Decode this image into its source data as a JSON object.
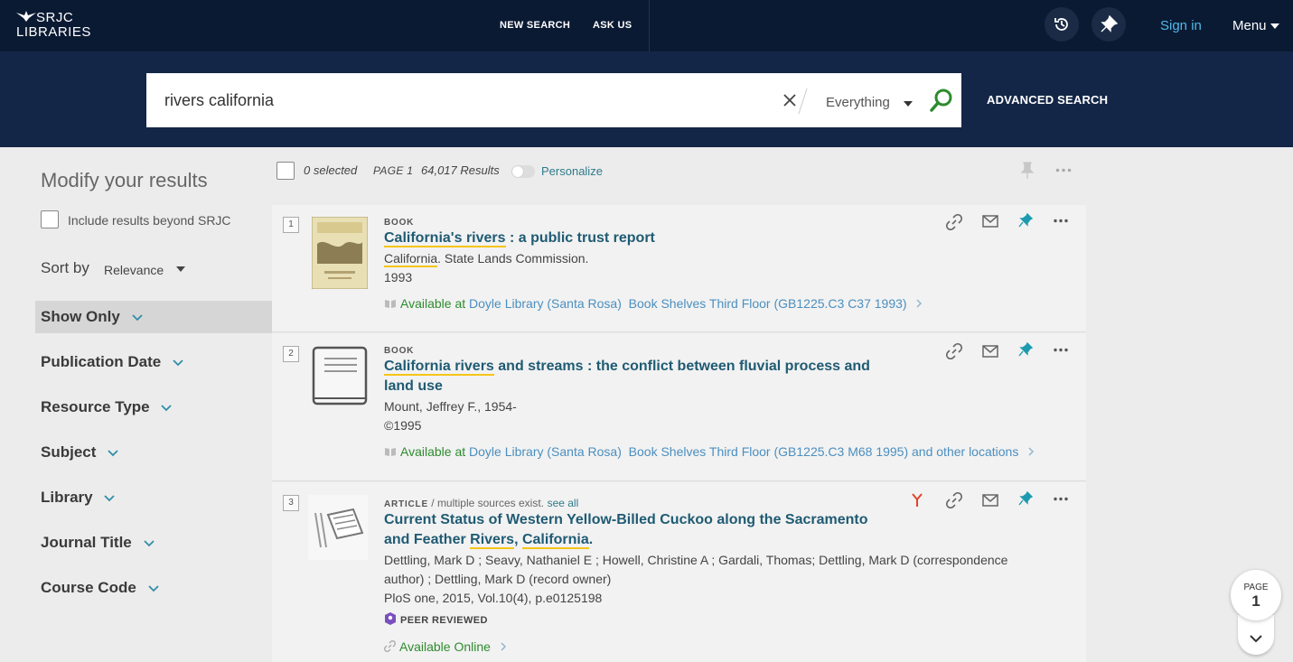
{
  "header": {
    "logo_line1": "SRJC",
    "logo_line2": "LIBRARIES",
    "nav": [
      "NEW SEARCH",
      "ASK US"
    ],
    "sign_in": "Sign in",
    "menu": "Menu"
  },
  "search": {
    "query": "rivers california",
    "scope": "Everything",
    "advanced": "ADVANCED SEARCH"
  },
  "facets": {
    "title": "Modify your results",
    "include_label": "Include results beyond SRJC",
    "sort_label": "Sort by",
    "sort_value": "Relevance",
    "items": [
      "Show Only",
      "Publication Date",
      "Resource Type",
      "Subject",
      "Library",
      "Journal Title",
      "Course Code"
    ]
  },
  "toolbar": {
    "selected": "0 selected",
    "page": "PAGE 1",
    "results": "64,017 Results",
    "personalize": "Personalize"
  },
  "results": [
    {
      "num": "1",
      "type": "BOOK",
      "title_hl": "California's rivers",
      "title_rest": " : a public trust report",
      "author_hl": "California",
      "author_rest": ". State Lands Commission.",
      "date": "1993",
      "avail_label": "Available at",
      "library": "Doyle Library (Santa Rosa)",
      "location": "Book Shelves Third Floor (GB1225.C3 C37 1993)"
    },
    {
      "num": "2",
      "type": "BOOK",
      "title_hl": "California rivers",
      "title_rest": " and streams : the conflict between fluvial process and",
      "title_line2": "land use",
      "author": "Mount, Jeffrey F., 1954-",
      "date": "©1995",
      "avail_label": "Available at",
      "library": "Doyle Library (Santa Rosa)",
      "location": "Book Shelves Third Floor (GB1225.C3 M68 1995) and other locations"
    },
    {
      "num": "3",
      "type": "ARTICLE",
      "type_note": " / multiple sources exist.",
      "see_all": "see all",
      "title_line1": "Current Status of Western Yellow-Billed Cuckoo along the Sacramento",
      "title_line2_a": "and Feather ",
      "title_hl1": "Rivers",
      "title_sep": ", ",
      "title_hl2": "California",
      "title_end": ".",
      "authors_line1": "Dettling, Mark D ; Seavy, Nathaniel E ; Howell, Christine A ; Gardali, Thomas; Dettling, Mark D (correspondence",
      "authors_line2": "author) ; Dettling, Mark D (record owner)",
      "source": "PloS one, 2015, Vol.10(4), p.e0125198",
      "peer": "PEER REVIEWED",
      "online": "Available Online"
    }
  ],
  "page_indicator": {
    "label": "PAGE",
    "number": "1"
  },
  "colors": {
    "header_bg": "#0b1a33",
    "search_band_bg": "#142647",
    "link": "#1f5b73",
    "available": "#2e8b2e",
    "pin": "#1c9bb0",
    "highlight": "#f5c518"
  }
}
